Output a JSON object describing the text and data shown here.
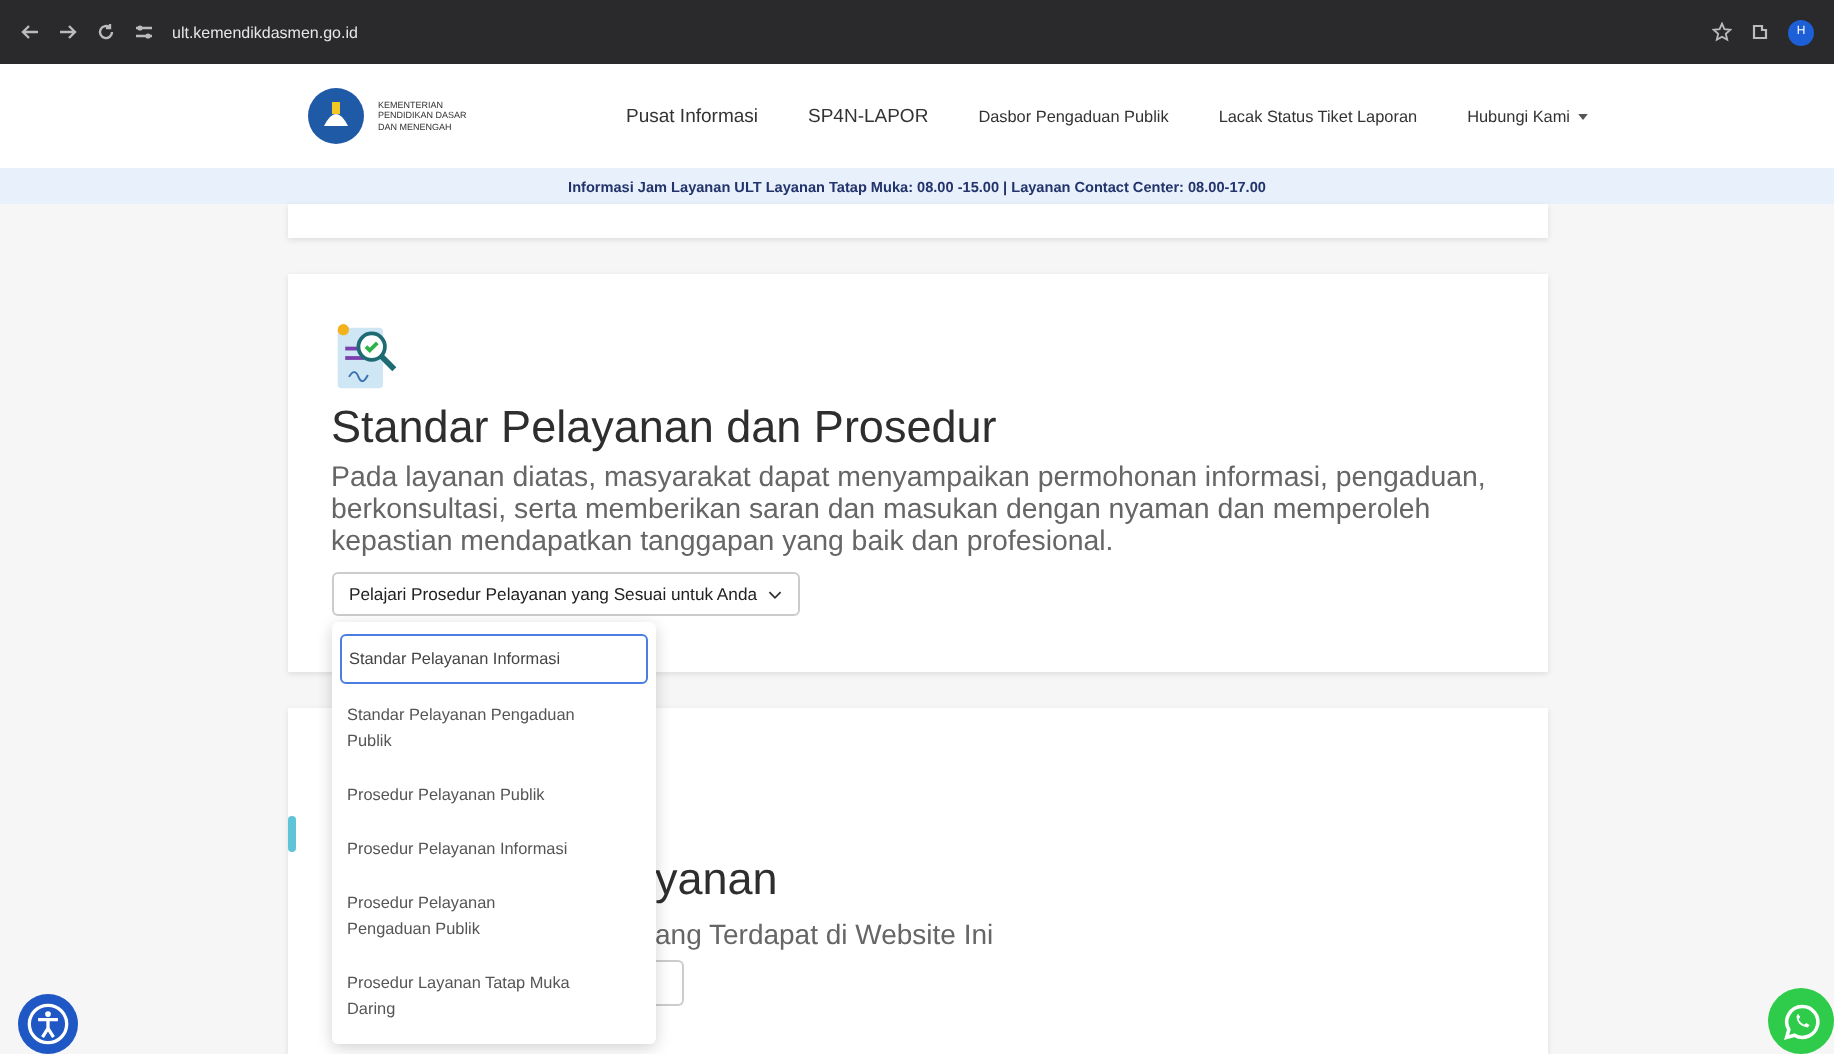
{
  "browser": {
    "url": "ult.kemendikdasmen.go.id",
    "profile": "H"
  },
  "header": {
    "logo_text": [
      "KEMENTERIAN",
      "PENDIDIKAN DASAR",
      "DAN MENENGAH"
    ],
    "nav": [
      {
        "label": "Pusat Informasi",
        "kind": "link"
      },
      {
        "label": "SP4N-LAPOR",
        "kind": "link"
      },
      {
        "label": "Dasbor Pengaduan Publik",
        "kind": "link"
      },
      {
        "label": "Lacak Status Tiket Laporan",
        "kind": "link"
      },
      {
        "label": "Hubungi Kami",
        "kind": "dropdown"
      }
    ]
  },
  "info_bar": "Informasi Jam Layanan ULT Layanan Tatap Muka: 08.00 -15.00 | Layanan Contact Center: 08.00-17.00",
  "section": {
    "title": "Standar Pelayanan dan Prosedur",
    "text": "Pada layanan diatas, masyarakat dapat menyampaikan permohonan informasi, pengaduan, berkonsultasi, serta memberikan saran dan masukan dengan nyaman dan memperoleh kepastian mendapatkan tanggapan yang baik dan profesional.",
    "dropdown": "Pelajari Prosedur Pelayanan yang Sesuai untuk Anda",
    "menu": [
      {
        "label": "Standar Pelayanan Informasi",
        "selected": true
      },
      {
        "label": "Standar Pelayanan Pengaduan Publik",
        "selected": false
      },
      {
        "label": "Prosedur Pelayanan Publik",
        "selected": false
      },
      {
        "label": "Prosedur Pelayanan Informasi",
        "selected": false
      },
      {
        "label": "Prosedur Pelayanan Pengaduan Publik",
        "selected": false
      },
      {
        "label": "Prosedur Layanan Tatap Muka Daring",
        "selected": false
      }
    ]
  },
  "next_section": {
    "title": "yanan",
    "text": "ang Terdapat di Website Ini"
  }
}
